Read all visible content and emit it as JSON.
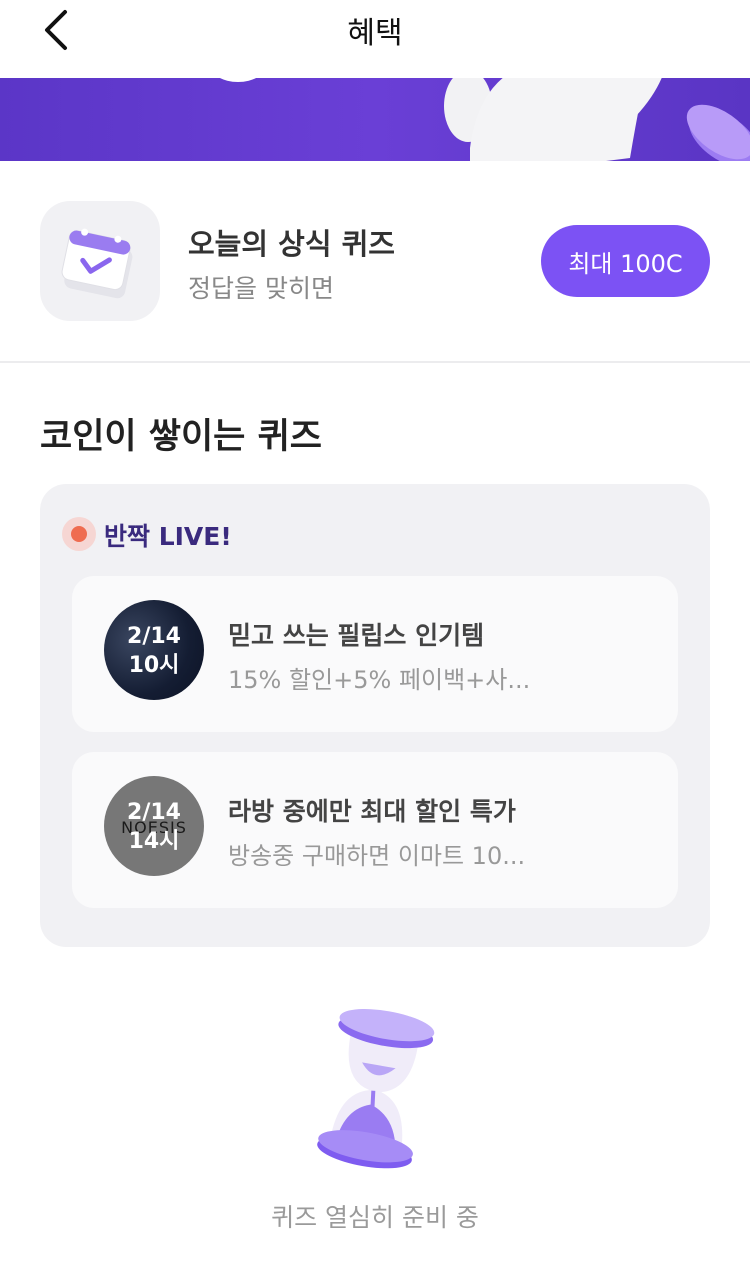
{
  "header": {
    "title": "혜택",
    "back_icon": "chevron-left-icon"
  },
  "daily_quiz": {
    "title": "오늘의 상식 퀴즈",
    "subtitle": "정답을 맞히면",
    "reward_label": "최대 100C",
    "icon": "calendar-check-icon",
    "accent_color": "#7c52f4"
  },
  "section": {
    "title": "코인이 쌓이는 퀴즈"
  },
  "live": {
    "label": "반짝 LIVE!",
    "items": [
      {
        "date": "2/14",
        "time": "10시",
        "title": "믿고 쓰는 필립스 인기템",
        "subtitle": "15% 할인+5% 페이백+사..."
      },
      {
        "date": "2/14",
        "time": "14시",
        "brand": "NOESIS",
        "title": "라방 중에만 최대 할인 특가",
        "subtitle": "방송중 구매하면 이마트 10..."
      }
    ]
  },
  "footer": {
    "status_text": "퀴즈 열심히 준비 중",
    "icon": "hourglass-icon"
  }
}
